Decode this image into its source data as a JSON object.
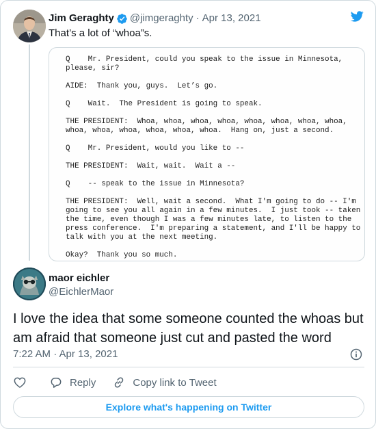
{
  "quoted_tweet": {
    "author_name": "Jim Geraghty",
    "handle": "@jimgeraghty",
    "separator": "·",
    "date": "Apr 13, 2021",
    "text": "That’s a lot of “whoa”s.",
    "verified": true,
    "image_transcript_lines": [
      "Q    Mr. President, could you speak to the issue in Minnesota,",
      "please, sir?",
      "",
      "AIDE:  Thank you, guys.  Let’s go.",
      "",
      "Q    Wait.  The President is going to speak.",
      "",
      "THE PRESIDENT:  Whoa, whoa, whoa, whoa, whoa, whoa, whoa, whoa,",
      "whoa, whoa, whoa, whoa, whoa, whoa.  Hang on, just a second.",
      "",
      "Q    Mr. President, would you like to --",
      "",
      "THE PRESIDENT:  Wait, wait.  Wait a --",
      "",
      "Q    -- speak to the issue in Minnesota?",
      "",
      "THE PRESIDENT:  Well, wait a second.  What I'm going to do -- I'm",
      "going to see you all again in a few minutes.  I just took -- taken",
      "the time, even though I was a few minutes late, to listen to the",
      "press conference.  I'm preparing a statement, and I'll be happy to",
      "talk with you at the next meeting.",
      "",
      "Okay?  Thank you so much."
    ]
  },
  "main_tweet": {
    "author_name": "maor eichler",
    "handle": "@EichlerMaor",
    "text": "I love the idea that some someone counted the whoas but am afraid that someone just cut and pasted the word",
    "timestamp": "7:22 AM · Apr 13, 2021"
  },
  "actions": {
    "like_icon": "heart-icon",
    "reply_label": "Reply",
    "copy_link_label": "Copy link to Tweet"
  },
  "explore_label": "Explore what's happening on Twitter",
  "colors": {
    "accent": "#1d9bf0",
    "text_primary": "#0f1419",
    "text_secondary": "#536471",
    "border": "#cfd9de"
  }
}
